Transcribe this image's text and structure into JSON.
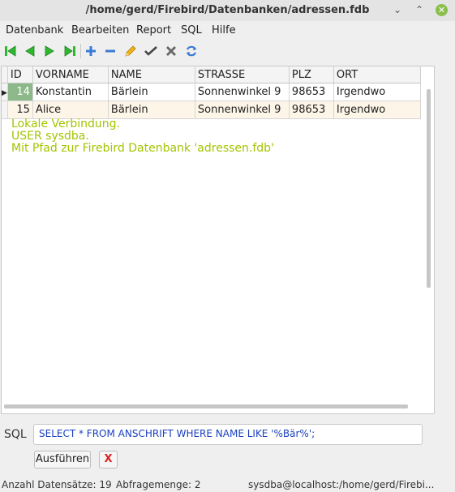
{
  "window": {
    "title": "/home/gerd/Firebird/Datenbanken/adressen.fdb",
    "minimize_glyph": "⌄",
    "maximize_glyph": "⌃",
    "close_glyph": "✕"
  },
  "menu": [
    "Datenbank",
    "Bearbeiten",
    "Report",
    "SQL",
    "Hilfe"
  ],
  "toolbar": {
    "icons": [
      "first-record-icon",
      "prior-record-icon",
      "next-record-icon",
      "last-record-icon",
      "insert-record-icon",
      "delete-record-icon",
      "edit-record-icon",
      "post-record-icon",
      "cancel-record-icon",
      "refresh-icon"
    ],
    "nav_color": "#2fb82f",
    "accent_color": "#3a7bd5"
  },
  "grid": {
    "columns": [
      "ID",
      "VORNAME",
      "NAME",
      "STRASSE",
      "PLZ",
      "ORT"
    ],
    "rows": [
      [
        "14",
        "Konstantin",
        "Bärlein",
        "Sonnenwinkel 9",
        "98653",
        "Irgendwo"
      ],
      [
        "15",
        "Alice",
        "Bärlein",
        "Sonnenwinkel 9",
        "98653",
        "Irgendwo"
      ]
    ],
    "current_row_marker": "▶",
    "selected_cell_color": "#8db88a",
    "alt_row_color": "#fdf5e8"
  },
  "info_lines": [
    "Lokale Verbindung.",
    "USER sysdba.",
    "Mit Pfad zur Firebird Datenbank 'adressen.fdb'"
  ],
  "info_color": "#a4c400",
  "sql": {
    "label": "SQL",
    "query": "SELECT * FROM ANSCHRIFT WHERE NAME LIKE '%Bär%';",
    "execute_label": "Ausführen",
    "cancel_label": "X"
  },
  "status": {
    "record_count": "Anzahl Datensätze: 19",
    "query_count": "Abfragemenge: 2",
    "connection": "sysdba@localhost:/home/gerd/Firebi..."
  }
}
